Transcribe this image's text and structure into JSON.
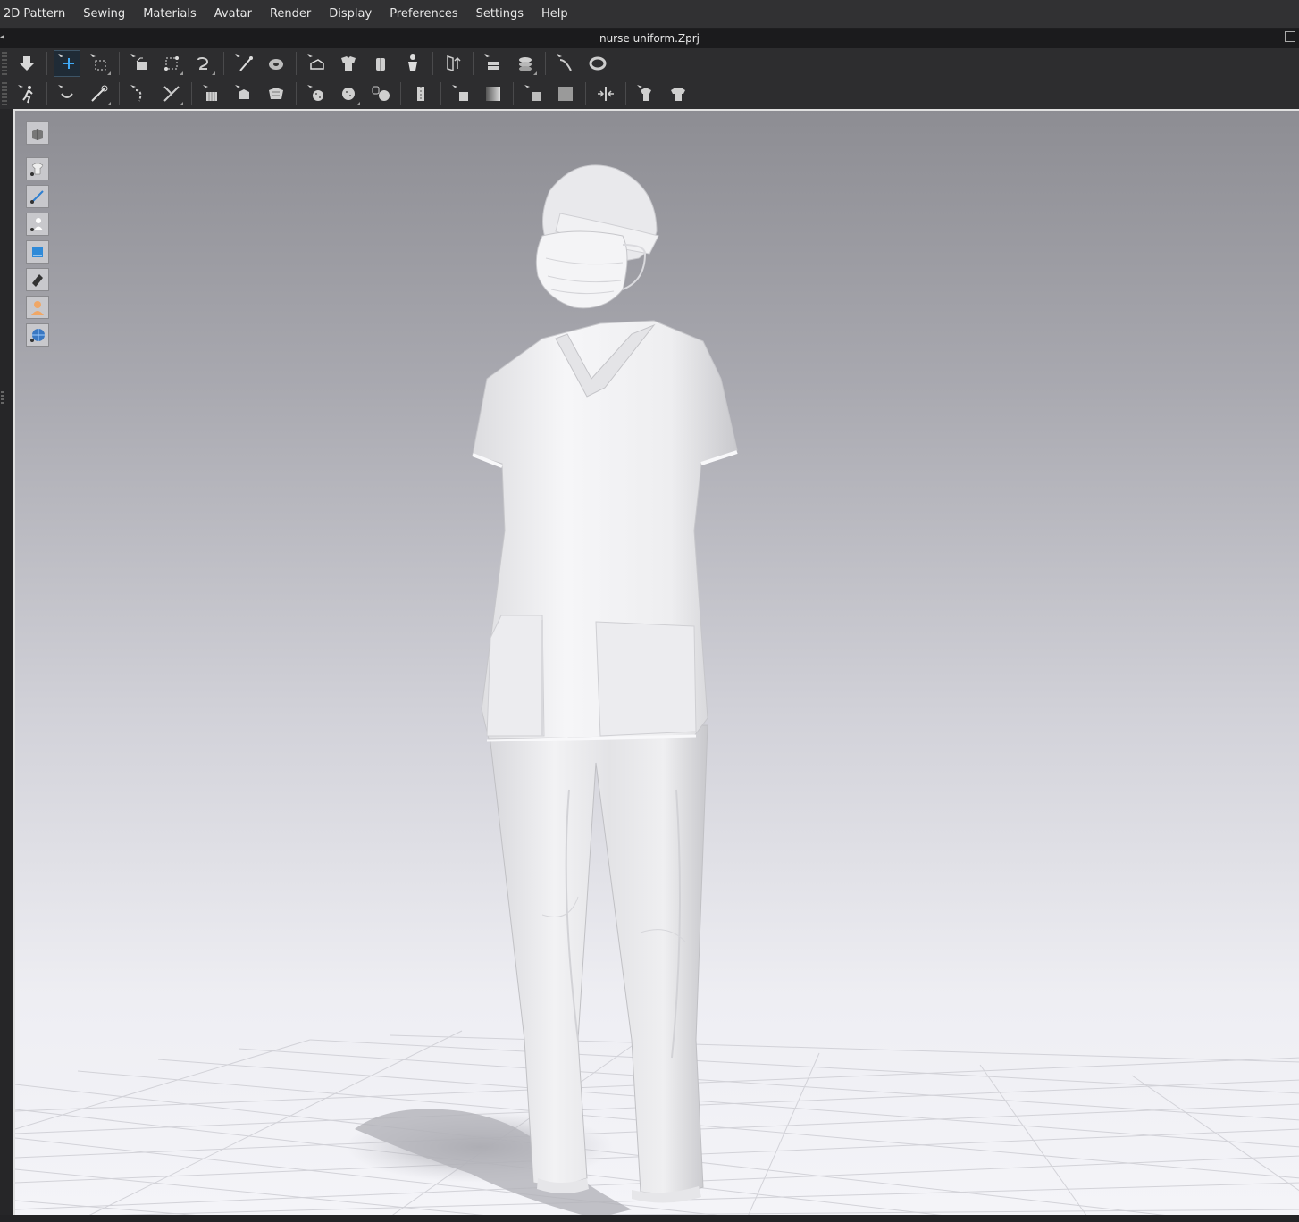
{
  "menubar": {
    "items": [
      "2D Pattern",
      "Sewing",
      "Materials",
      "Avatar",
      "Render",
      "Display",
      "Preferences",
      "Settings",
      "Help"
    ]
  },
  "window": {
    "title": "nurse uniform.Zprj"
  },
  "toolbar1": {
    "icons": [
      "simulate-icon",
      "select-move-icon",
      "select-box-icon",
      "fold-arrangement-icon",
      "fold-arrangement-2-icon",
      "fold-icon",
      "pin-icon",
      "tape-icon",
      "fabric-box-icon",
      "arrangement-icon",
      "arrangement-body-icon",
      "avatar-arrangement-icon",
      "strengthen-icon",
      "layer-icon",
      "layer-stack-icon",
      "measure-icon",
      "circumference-icon"
    ]
  },
  "toolbar2": {
    "icons": [
      "avatar-pose-icon",
      "edit-sewing-icon",
      "edit-needle-icon",
      "topstitch-icon",
      "topstitch-edit-icon",
      "puckering-icon",
      "zipper-icon",
      "trim-icon",
      "button-icon",
      "buttonhole-icon",
      "lock-button-icon",
      "zipper-pull-icon",
      "shirring-icon",
      "shading-icon",
      "texture-icon",
      "fill-icon",
      "split-icon",
      "garment-icon",
      "garment-2-icon"
    ]
  },
  "viewport_tools": {
    "icons": [
      "view-cube-icon",
      "show-garment-icon",
      "show-sewing-icon",
      "show-avatar-icon",
      "show-fabric-icon",
      "show-shading-icon",
      "avatar-skin-icon",
      "world-icon"
    ]
  }
}
